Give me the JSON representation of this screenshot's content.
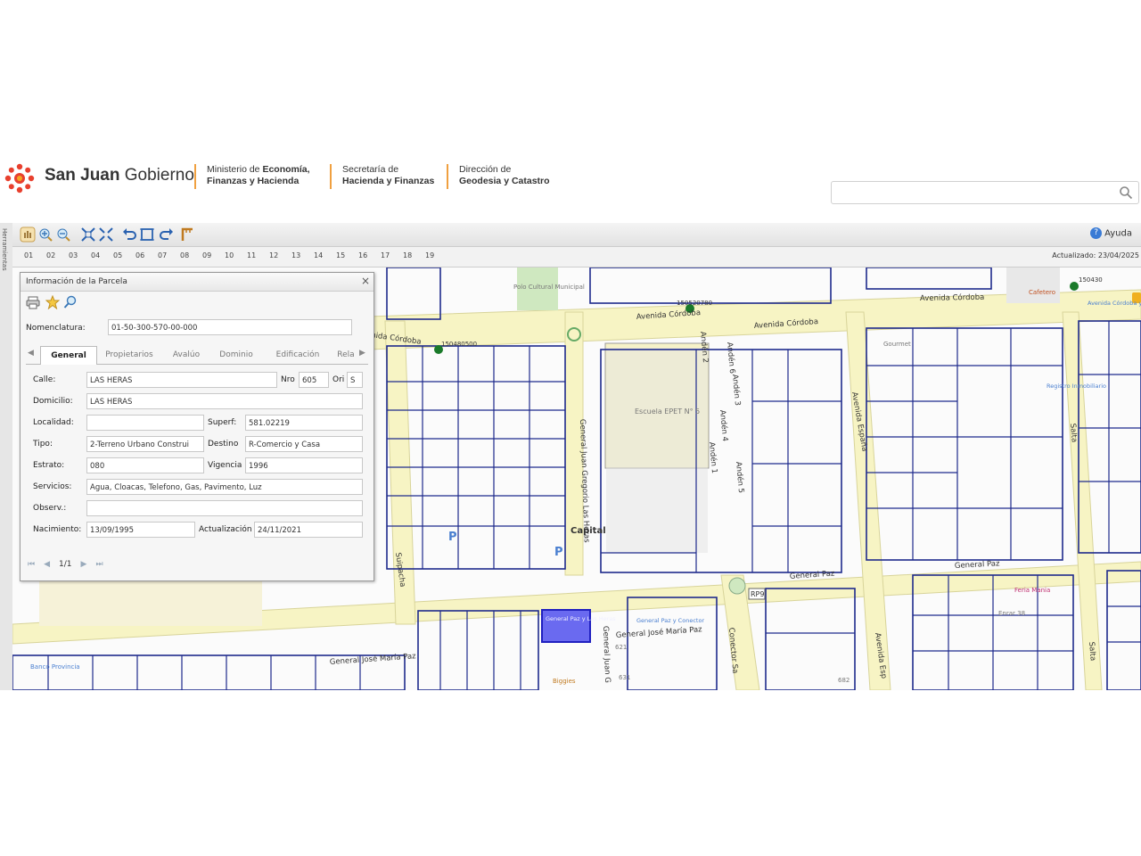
{
  "header": {
    "brand_bold": "San Juan",
    "brand_rest": " Gobierno",
    "ministry_line1": "Ministerio de ",
    "ministry_line1_bold": "Economía,",
    "ministry_line2": "Finanzas y Hacienda",
    "secretaria_line1": "Secretaría de",
    "secretaria_line2": "Hacienda y Finanzas",
    "direccion_line1": "Dirección de",
    "direccion_line2": "Geodesia y Catastro",
    "brand_color": "#e8402e"
  },
  "search": {
    "placeholder": ""
  },
  "toolbar": {
    "help_label": "Ayuda"
  },
  "side_strip_label": "Herramientas",
  "zoom_levels": [
    "01",
    "02",
    "03",
    "04",
    "05",
    "06",
    "07",
    "08",
    "09",
    "10",
    "11",
    "12",
    "13",
    "14",
    "15",
    "16",
    "17",
    "18",
    "19"
  ],
  "updated_label": "Actualizado: 23/04/2025",
  "parcel_panel": {
    "title": "Información de la Parcela",
    "nomenclatura_label": "Nomenclatura:",
    "nomenclatura_value": "01-50-300-570-00-000",
    "tabs": [
      "General",
      "Propietarios",
      "Avalúo",
      "Dominio",
      "Edificación",
      "Rela"
    ],
    "active_tab": "General",
    "fields": {
      "calle_label": "Calle:",
      "calle": "LAS HERAS",
      "nro_label": "Nro",
      "nro": "605",
      "ori_label": "Ori",
      "ori": "S",
      "domicilio_label": "Domicilio:",
      "domicilio": "LAS HERAS",
      "localidad_label": "Localidad:",
      "localidad": "",
      "superf_label": "Superf:",
      "superf": "581.02219",
      "tipo_label": "Tipo:",
      "tipo": "2-Terreno Urbano Construi",
      "destino_label": "Destino",
      "destino": "R-Comercio y Casa",
      "estrato_label": "Estrato:",
      "estrato": "080",
      "vigencia_label": "Vigencia",
      "vigencia": "1996",
      "servicios_label": "Servicios:",
      "servicios": "Agua, Cloacas, Telefono, Gas, Pavimento, Luz",
      "observ_label": "Observ.:",
      "observ": "",
      "nacimiento_label": "Nacimiento:",
      "nacimiento": "13/09/1995",
      "actualizacion_label": "Actualización",
      "actualizacion": "24/11/2021"
    },
    "pager": "1/1"
  },
  "map_labels": {
    "av_cordoba_1": "Avenida Córdoba",
    "av_cordoba_2": "Avenida Córdoba",
    "av_cordoba_3": "Avenida Córdoba",
    "av_cordoba_left": "nida Córdoba",
    "gen_paz_1": "General José María Paz",
    "gen_paz_2": "General José María Paz",
    "gen_paz_3": "General Paz",
    "gen_paz_4": "General Paz",
    "av_espana": "Avenida España",
    "av_espana_2": "Avenida Esp",
    "gen_juan_gregorio": "General Juan Gregorio Las Heras",
    "gen_juan_g": "General Juan G",
    "salta_1": "Salta",
    "salta_2": "Salta",
    "suipacha": "Suipacha",
    "conector": "Conector Sa",
    "anden_1": "Andén 1",
    "anden_2": "Andén 2",
    "anden_3": "Andén 3",
    "anden_4": "Andén 4",
    "anden_5": "Andén 5",
    "anden_6": "Andén 6",
    "escuela": "Escuela EPET N° 5",
    "polo": "Polo Cultural Municipal",
    "capital": "Capital",
    "rp9": "RP9",
    "code_1": "150520780",
    "code_2": "150480500",
    "code_3": "150430",
    "parada": "General Paz y Las Heras",
    "conector_stop": "General Paz y Conector",
    "cafe": "Cafetero",
    "av_cordoba_salta": "Avenida Córdoba y Salta",
    "enrar": "Enrar 38",
    "biggies": "Biggies",
    "provincia": "Banco Provincia",
    "feria": "Feria Mania",
    "registro": "Registro Inmobiliario",
    "gourmet": "Gourmet",
    "num_682": "682",
    "num_621": "621",
    "num_631": "631"
  }
}
